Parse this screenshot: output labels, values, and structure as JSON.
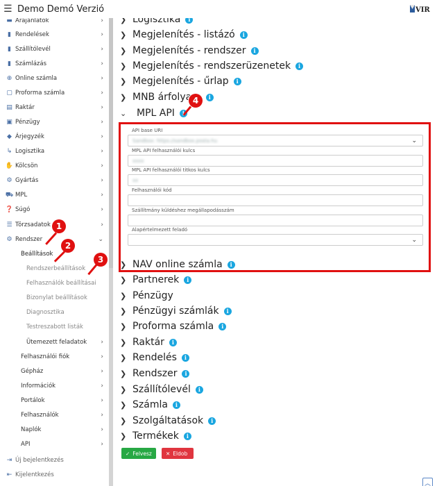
{
  "header": {
    "title": "Demo Demó Verzió",
    "logo_text": "VIR"
  },
  "sidebar": {
    "items": [
      {
        "label": "Árajánlatok",
        "icon": "list-icon",
        "top": 0
      },
      {
        "label": "Rendelések",
        "icon": "file-icon"
      },
      {
        "label": "Szállítólevél",
        "icon": "file-icon"
      },
      {
        "label": "Számlázás",
        "icon": "file-icon"
      },
      {
        "label": "Online számla",
        "icon": "globe-icon"
      },
      {
        "label": "Proforma számla",
        "icon": "document-icon"
      },
      {
        "label": "Raktár",
        "icon": "warehouse-icon"
      },
      {
        "label": "Pénzügy",
        "icon": "money-icon"
      },
      {
        "label": "Árjegyzék",
        "icon": "tag-icon"
      },
      {
        "label": "Logisztika",
        "icon": "dolly-icon"
      },
      {
        "label": "Kölcsön",
        "icon": "hand-icon"
      },
      {
        "label": "Gyártás",
        "icon": "cogs-icon"
      },
      {
        "label": "MPL",
        "icon": "truck-icon"
      },
      {
        "label": "Súgó",
        "icon": "help-icon"
      },
      {
        "label": "Törzsadatok",
        "icon": "database-icon"
      },
      {
        "label": "Rendszer",
        "icon": "gears-icon"
      }
    ],
    "settings": "Beállítások",
    "settings_children": [
      "Rendszerbeállítások",
      "Felhasználók beállításai",
      "Bizonylat beállítások",
      "Diagnosztika",
      "Testreszabott listák",
      "Ütemezett feladatok"
    ],
    "system_children": [
      "Felhasználói fiók",
      "Gépház",
      "Információk",
      "Portálok",
      "Felhasználók",
      "Naplók",
      "API"
    ],
    "bottom": [
      "Új bejelentkezés",
      "Kijelentkezés"
    ]
  },
  "sections_top": [
    "Logisztika",
    "Megjelenítés - listázó",
    "Megjelenítés - rendszer",
    "Megjelenítés - rendszerüzenetek",
    "Megjelenítés - űrlap",
    "MNB árfolyam",
    "MPL API"
  ],
  "sections_bottom": [
    "NAV online számla",
    "Partnerek",
    "Pénzügy",
    "Pénzügyi számlák",
    "Proforma számla",
    "Raktár",
    "Rendelés",
    "Rendszer",
    "Szállítólevél",
    "Számla",
    "Szolgáltatások",
    "Termékek"
  ],
  "mpl": {
    "fields": [
      {
        "label": "API base URI",
        "value": "Sandbox: https://sandbox.posta.hu",
        "dropdown": true
      },
      {
        "label": "MPL API felhasználói kulcs",
        "value": "xxxx",
        "dropdown": false
      },
      {
        "label": "MPL API felhasználói titkos kulcs",
        "value": "xx",
        "dropdown": false
      },
      {
        "label": "Felhasználói kód",
        "value": "",
        "dropdown": false
      },
      {
        "label": "Szállítmány küldéshez megállapodásszám",
        "value": "",
        "dropdown": false
      },
      {
        "label": "Alapértelmezett feladó",
        "value": "",
        "dropdown": true
      }
    ]
  },
  "buttons": {
    "save": "Felvesz",
    "cancel": "Eldob"
  },
  "callouts": [
    "1",
    "2",
    "3",
    "4"
  ],
  "colors": {
    "accent_info": "#1aa6e0",
    "highlight": "#e01010",
    "save": "#27a844",
    "cancel": "#e0353f"
  }
}
